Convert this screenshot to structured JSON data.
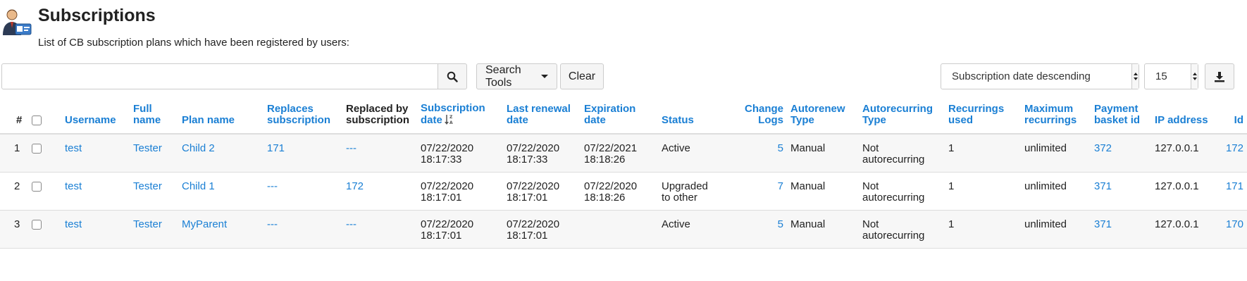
{
  "header": {
    "title": "Subscriptions",
    "subtitle": "List of CB subscription plans which have been registered by users:",
    "icon": "user-card-icon"
  },
  "toolbar": {
    "search_value": "",
    "search_placeholder": "",
    "search_tools_label": "Search Tools",
    "clear_label": "Clear",
    "sort_value": "Subscription date descending",
    "limit_value": "15",
    "export_icon": "download-icon"
  },
  "table": {
    "headers": {
      "num": "#",
      "username": "Username",
      "full_name": "Full name",
      "plan_name": "Plan name",
      "replaces": "Replaces subscription",
      "replaced_by": "Replaced by subscription",
      "sub_date": "Subscription date",
      "last_renewal": "Last renewal date",
      "expiration": "Expiration date",
      "status": "Status",
      "change_logs": "Change Logs",
      "autorenew": "Autorenew Type",
      "autorecurring": "Autorecurring Type",
      "recurrings_used": "Recurrings used",
      "max_recurrings": "Maximum recurrings",
      "payment_basket": "Payment basket id",
      "ip": "IP address",
      "id": "Id"
    },
    "rows": [
      {
        "num": "1",
        "username": "test",
        "full_name": "Tester",
        "plan_name": "Child 2",
        "replaces": "171",
        "replaced_by": "---",
        "sub_date": "07/22/2020",
        "sub_time": "18:17:33",
        "last_renewal_date": "07/22/2020",
        "last_renewal_time": "18:17:33",
        "expiration_date": "07/22/2021",
        "expiration_time": "18:18:26",
        "status_1": "Active",
        "status_2": "",
        "change_logs": "5",
        "autorenew": "Manual",
        "autorecurring_1": "Not",
        "autorecurring_2": "autorecurring",
        "recurrings_used": "1",
        "max_recurrings": "unlimited",
        "payment_basket": "372",
        "ip": "127.0.0.1",
        "id": "172"
      },
      {
        "num": "2",
        "username": "test",
        "full_name": "Tester",
        "plan_name": "Child 1",
        "replaces": "---",
        "replaced_by": "172",
        "sub_date": "07/22/2020",
        "sub_time": "18:17:01",
        "last_renewal_date": "07/22/2020",
        "last_renewal_time": "18:17:01",
        "expiration_date": "07/22/2020",
        "expiration_time": "18:18:26",
        "status_1": "Upgraded",
        "status_2": "to other",
        "change_logs": "7",
        "autorenew": "Manual",
        "autorecurring_1": "Not",
        "autorecurring_2": "autorecurring",
        "recurrings_used": "1",
        "max_recurrings": "unlimited",
        "payment_basket": "371",
        "ip": "127.0.0.1",
        "id": "171"
      },
      {
        "num": "3",
        "username": "test",
        "full_name": "Tester",
        "plan_name": "MyParent",
        "replaces": "---",
        "replaced_by": "---",
        "sub_date": "07/22/2020",
        "sub_time": "18:17:01",
        "last_renewal_date": "07/22/2020",
        "last_renewal_time": "18:17:01",
        "expiration_date": "",
        "expiration_time": "",
        "status_1": "Active",
        "status_2": "",
        "change_logs": "5",
        "autorenew": "Manual",
        "autorecurring_1": "Not",
        "autorecurring_2": "autorecurring",
        "recurrings_used": "1",
        "max_recurrings": "unlimited",
        "payment_basket": "371",
        "ip": "127.0.0.1",
        "id": "170"
      }
    ]
  },
  "colors": {
    "link": "#1a7fd4",
    "row_alt": "#f7f7f7",
    "border": "#dddddd"
  }
}
